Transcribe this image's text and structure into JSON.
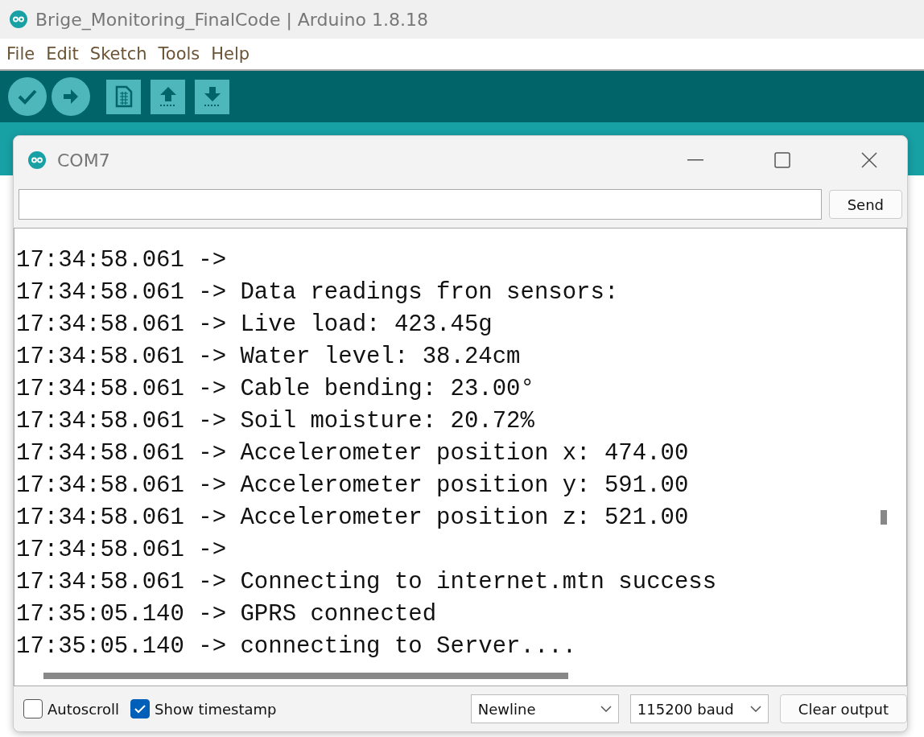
{
  "window": {
    "title": "Brige_Monitoring_FinalCode | Arduino 1.8.18"
  },
  "menu": [
    "File",
    "Edit",
    "Sketch",
    "Tools",
    "Help"
  ],
  "serial_monitor": {
    "title": "COM7",
    "send_button": "Send",
    "lines": [
      "17:34:58.061 ->",
      "17:34:58.061 -> Data readings fron sensors:",
      "17:34:58.061 -> Live load: 423.45g",
      "17:34:58.061 -> Water level: 38.24cm",
      "17:34:58.061 -> Cable bending: 23.00°",
      "17:34:58.061 -> Soil moisture: 20.72%",
      "17:34:58.061 -> Accelerometer position x: 474.00",
      "17:34:58.061 -> Accelerometer position y: 591.00",
      "17:34:58.061 -> Accelerometer position z: 521.00",
      "17:34:58.061 ->",
      "17:34:58.061 -> Connecting to internet.mtn success",
      "17:35:05.140 -> GPRS connected",
      "17:35:05.140 -> connecting to Server...."
    ],
    "options": [
      {
        "label": "Autoscroll",
        "checked": false
      },
      {
        "label": "Show timestamp",
        "checked": true
      }
    ],
    "line_ending": "Newline",
    "baud": "115200 baud",
    "clear_button": "Clear output"
  }
}
